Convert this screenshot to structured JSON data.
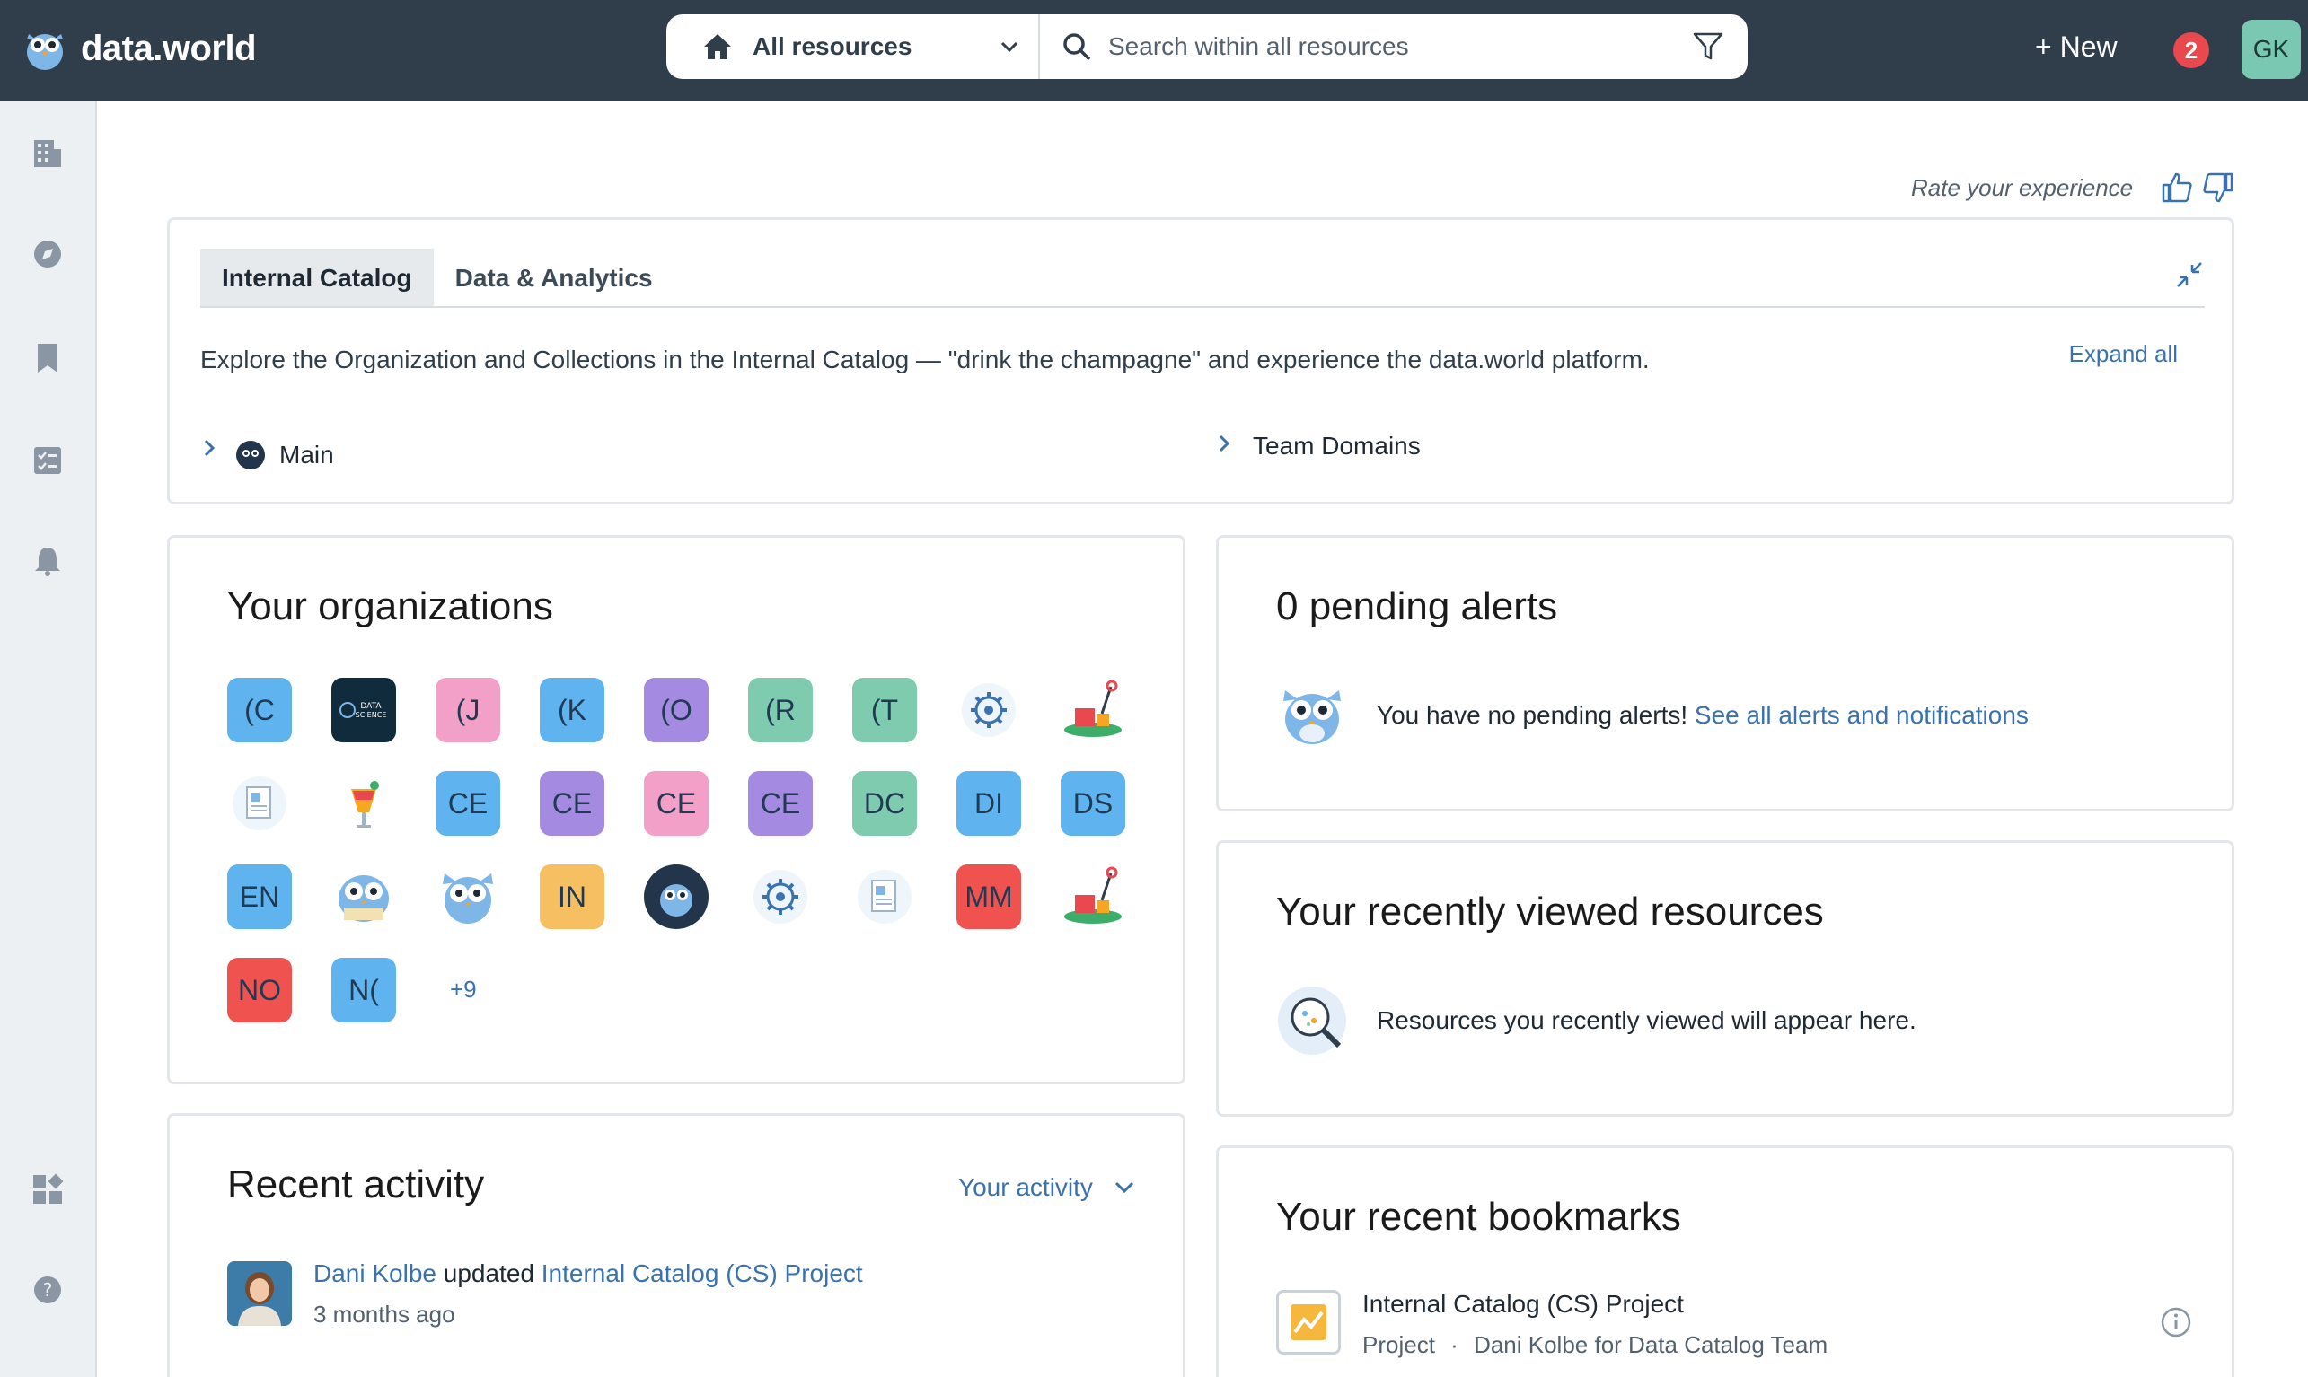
{
  "header": {
    "brand": "data.world",
    "scope_label": "All resources",
    "search_placeholder": "Search within all resources",
    "new_label": "+ New",
    "notification_count": "2",
    "user_initials": "GK"
  },
  "sidebar": {
    "icons": [
      "organizations-icon",
      "explore-icon",
      "bookmark-icon",
      "tasks-icon",
      "notifications-icon",
      "apps-icon",
      "help-icon"
    ]
  },
  "rate": {
    "label": "Rate your experience"
  },
  "catalog": {
    "tabs": [
      "Internal Catalog",
      "Data & Analytics"
    ],
    "description": "Explore the Organization and Collections in the Internal Catalog — \"drink the champagne\" and experience the data.world platform.",
    "expand_all": "Expand all",
    "tree": [
      "Main",
      "Team Domains"
    ]
  },
  "organizations": {
    "title": "Your organizations",
    "items": [
      {
        "label": "(C",
        "color": "#5fb3ef"
      },
      {
        "label": "DATA SCIENCE",
        "color": "#0f2b3c"
      },
      {
        "label": "(J",
        "color": "#f3a0c8"
      },
      {
        "label": "(K",
        "color": "#5fb3ef"
      },
      {
        "label": "(O",
        "color": "#a48ae0"
      },
      {
        "label": "(R",
        "color": "#7ecbb0"
      },
      {
        "label": "(T",
        "color": "#7ecbb0"
      },
      {
        "label": "gear",
        "color": "#ffffff"
      },
      {
        "label": "sandcastle",
        "color": "#ffffff"
      },
      {
        "label": "docs",
        "color": "#ffffff"
      },
      {
        "label": "cocktail",
        "color": "#ffffff"
      },
      {
        "label": "CE",
        "color": "#5fb3ef"
      },
      {
        "label": "CE",
        "color": "#a48ae0"
      },
      {
        "label": "CE",
        "color": "#f3a0c8"
      },
      {
        "label": "CE",
        "color": "#a48ae0"
      },
      {
        "label": "DC",
        "color": "#7ecbb0"
      },
      {
        "label": "DI",
        "color": "#5fb3ef"
      },
      {
        "label": "DS",
        "color": "#5fb3ef"
      },
      {
        "label": "EN",
        "color": "#5fb3ef"
      },
      {
        "label": "owl-reading",
        "color": "#ffffff"
      },
      {
        "label": "owl",
        "color": "#ffffff"
      },
      {
        "label": "IN",
        "color": "#f6c062"
      },
      {
        "label": "owl-dark",
        "color": "#22354a"
      },
      {
        "label": "gear",
        "color": "#ffffff"
      },
      {
        "label": "docs",
        "color": "#ffffff"
      },
      {
        "label": "MM",
        "color": "#f0534f"
      },
      {
        "label": "sandcastle",
        "color": "#ffffff"
      },
      {
        "label": "NO",
        "color": "#f0534f"
      },
      {
        "label": "N(",
        "color": "#5fb3ef"
      }
    ],
    "more": "+9"
  },
  "alerts": {
    "title": "0 pending alerts",
    "message": "You have no pending alerts!",
    "link": "See all alerts and notifications"
  },
  "recent": {
    "title": "Your recently viewed resources",
    "message": "Resources you recently viewed will appear here."
  },
  "activity": {
    "title": "Recent activity",
    "filter": "Your activity",
    "actor": "Dani Kolbe",
    "verb": "updated",
    "target": "Internal Catalog (CS) Project",
    "time": "3 months ago"
  },
  "bookmarks": {
    "title": "Your recent bookmarks",
    "item_title": "Internal Catalog (CS) Project",
    "item_type": "Project",
    "item_owner": "Dani Kolbe for Data Catalog Team"
  }
}
